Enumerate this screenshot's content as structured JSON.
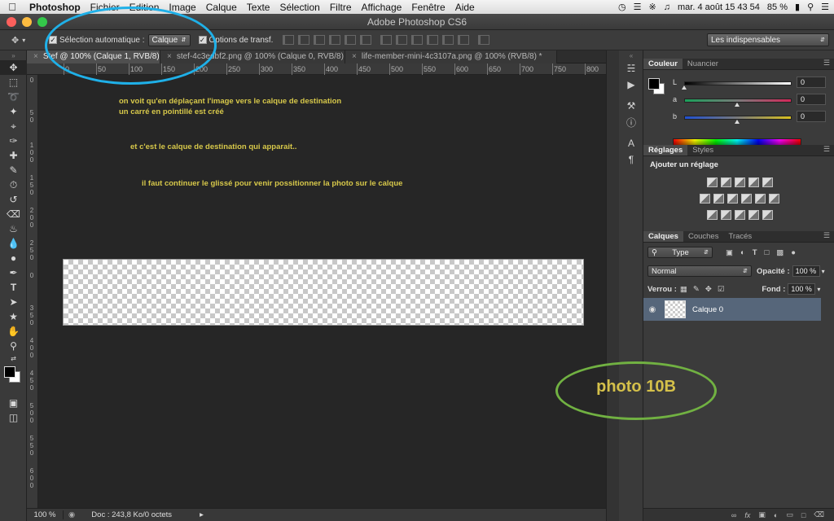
{
  "menubar": {
    "apple": "",
    "items": [
      "Photoshop",
      "Fichier",
      "Edition",
      "Image",
      "Calque",
      "Texte",
      "Sélection",
      "Filtre",
      "Affichage",
      "Fenêtre",
      "Aide"
    ],
    "datetime": "mar. 4 août  15 43 54",
    "battery": "85 %"
  },
  "window": {
    "title": "Adobe Photoshop CS6"
  },
  "options": {
    "auto_select_label": "Sélection automatique :",
    "auto_select_value": "Calque",
    "transform_label": "Options de transf.",
    "workspace": "Les indispensables"
  },
  "tabs": [
    {
      "label": "Stef @ 100% (Calque 1, RVB/8)"
    },
    {
      "label": "stef-4c3edbf2.png @ 100% (Calque 0, RVB/8)"
    },
    {
      "label": "life-member-mini-4c3107a.png @ 100% (RVB/8) *"
    }
  ],
  "ruler": {
    "marks": [
      "0",
      "50",
      "100",
      "150",
      "200",
      "250",
      "300",
      "350",
      "400",
      "450",
      "500",
      "550",
      "600",
      "650",
      "700",
      "750",
      "800"
    ],
    "vmarks": [
      "0",
      "5\n0",
      "1\n0\n0",
      "1\n5\n0",
      "2\n0\n0",
      "2\n5\n0",
      "0",
      "3\n5\n0",
      "4\n0\n0",
      "4\n5\n0",
      "5\n0\n0",
      "5\n5\n0",
      "6\n0\n0"
    ]
  },
  "canvas": {
    "note1": "on voit qu'en déplaçant l'image vers le calque de destination",
    "note2": "un carré en pointillé est créé",
    "note3": "et c'est le calque de destination qui apparait..",
    "note4": "il faut continuer le glissé pour venir possitionner la photo sur le calque"
  },
  "status": {
    "zoom": "100 %",
    "doc": "Doc : 243,8 Ko/0 octets"
  },
  "color_panel": {
    "tabs": [
      "Couleur",
      "Nuancier"
    ],
    "sliders": [
      {
        "label": "L",
        "value": "0",
        "knob": 0.0
      },
      {
        "label": "a",
        "value": "0",
        "knob": 0.5
      },
      {
        "label": "b",
        "value": "0",
        "knob": 0.5
      }
    ]
  },
  "adjust_panel": {
    "tabs": [
      "Réglages",
      "Styles"
    ],
    "title": "Ajouter un réglage"
  },
  "layers_panel": {
    "tabs": [
      "Calques",
      "Couches",
      "Tracés"
    ],
    "filter": "Type",
    "blend": "Normal",
    "opacity_label": "Opacité :",
    "opacity": "100 %",
    "lock_label": "Verrou :",
    "fill_label": "Fond :",
    "fill": "100 %",
    "layer_name": "Calque 0"
  },
  "annotation": {
    "label": "photo 10B"
  },
  "colors": {
    "accent_blue": "#1fb0e8",
    "accent_green": "#71b142",
    "note_text": "#d7c84a"
  }
}
